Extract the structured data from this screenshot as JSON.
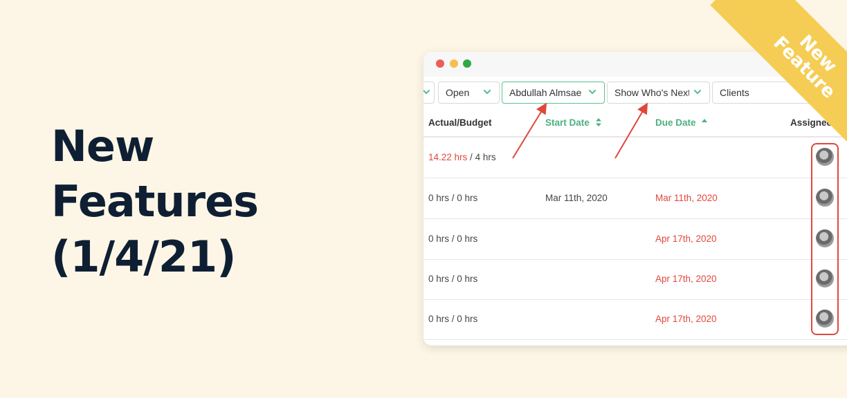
{
  "headline": {
    "lines": [
      "New",
      "Features",
      "(1/4/21)"
    ]
  },
  "ribbon": {
    "lines": [
      "New",
      "Feature"
    ]
  },
  "colors": {
    "background": "#fdf6e6",
    "headline": "#0f1f33",
    "accent_green": "#4bb07e",
    "overdue_red": "#e0473b",
    "ribbon": "#f5cd55",
    "dot_red": "#ec5f56",
    "dot_yellow": "#f4bf4f",
    "dot_green": "#2fa846"
  },
  "window": {
    "filters": [
      {
        "label": "",
        "icon": "chevron-down-icon"
      },
      {
        "label": "Open",
        "icon": "chevron-down-icon"
      },
      {
        "label": "Abdullah Almsae",
        "icon": "chevron-down-icon",
        "active": true
      },
      {
        "label": "Show Who's Next",
        "icon": "chevron-down-icon"
      },
      {
        "label": "Clients",
        "icon": "chevron-down-icon"
      }
    ],
    "columns": [
      {
        "label": "Actual/Budget"
      },
      {
        "label": "Start Date",
        "sort_icon": "sort-updown-icon"
      },
      {
        "label": "Due Date",
        "sort_icon": "sort-asc-icon"
      },
      {
        "label": "Assignees"
      }
    ],
    "rows": [
      {
        "actual": "14.22 hrs",
        "separator": " / ",
        "budget": "4 hrs",
        "actual_over": true,
        "start_date": "",
        "due_date": "",
        "assignee": "avatar"
      },
      {
        "actual": "0 hrs",
        "separator": " / ",
        "budget": "0 hrs",
        "actual_over": false,
        "start_date": "Mar 11th, 2020",
        "due_date": "Mar 11th, 2020",
        "assignee": "avatar"
      },
      {
        "actual": "0 hrs",
        "separator": " / ",
        "budget": "0 hrs",
        "actual_over": false,
        "start_date": "",
        "due_date": "Apr 17th, 2020",
        "assignee": "avatar"
      },
      {
        "actual": "0 hrs",
        "separator": " / ",
        "budget": "0 hrs",
        "actual_over": false,
        "start_date": "",
        "due_date": "Apr 17th, 2020",
        "assignee": "avatar"
      },
      {
        "actual": "0 hrs",
        "separator": " / ",
        "budget": "0 hrs",
        "actual_over": false,
        "start_date": "",
        "due_date": "Apr 17th, 2020",
        "assignee": "avatar"
      }
    ]
  }
}
